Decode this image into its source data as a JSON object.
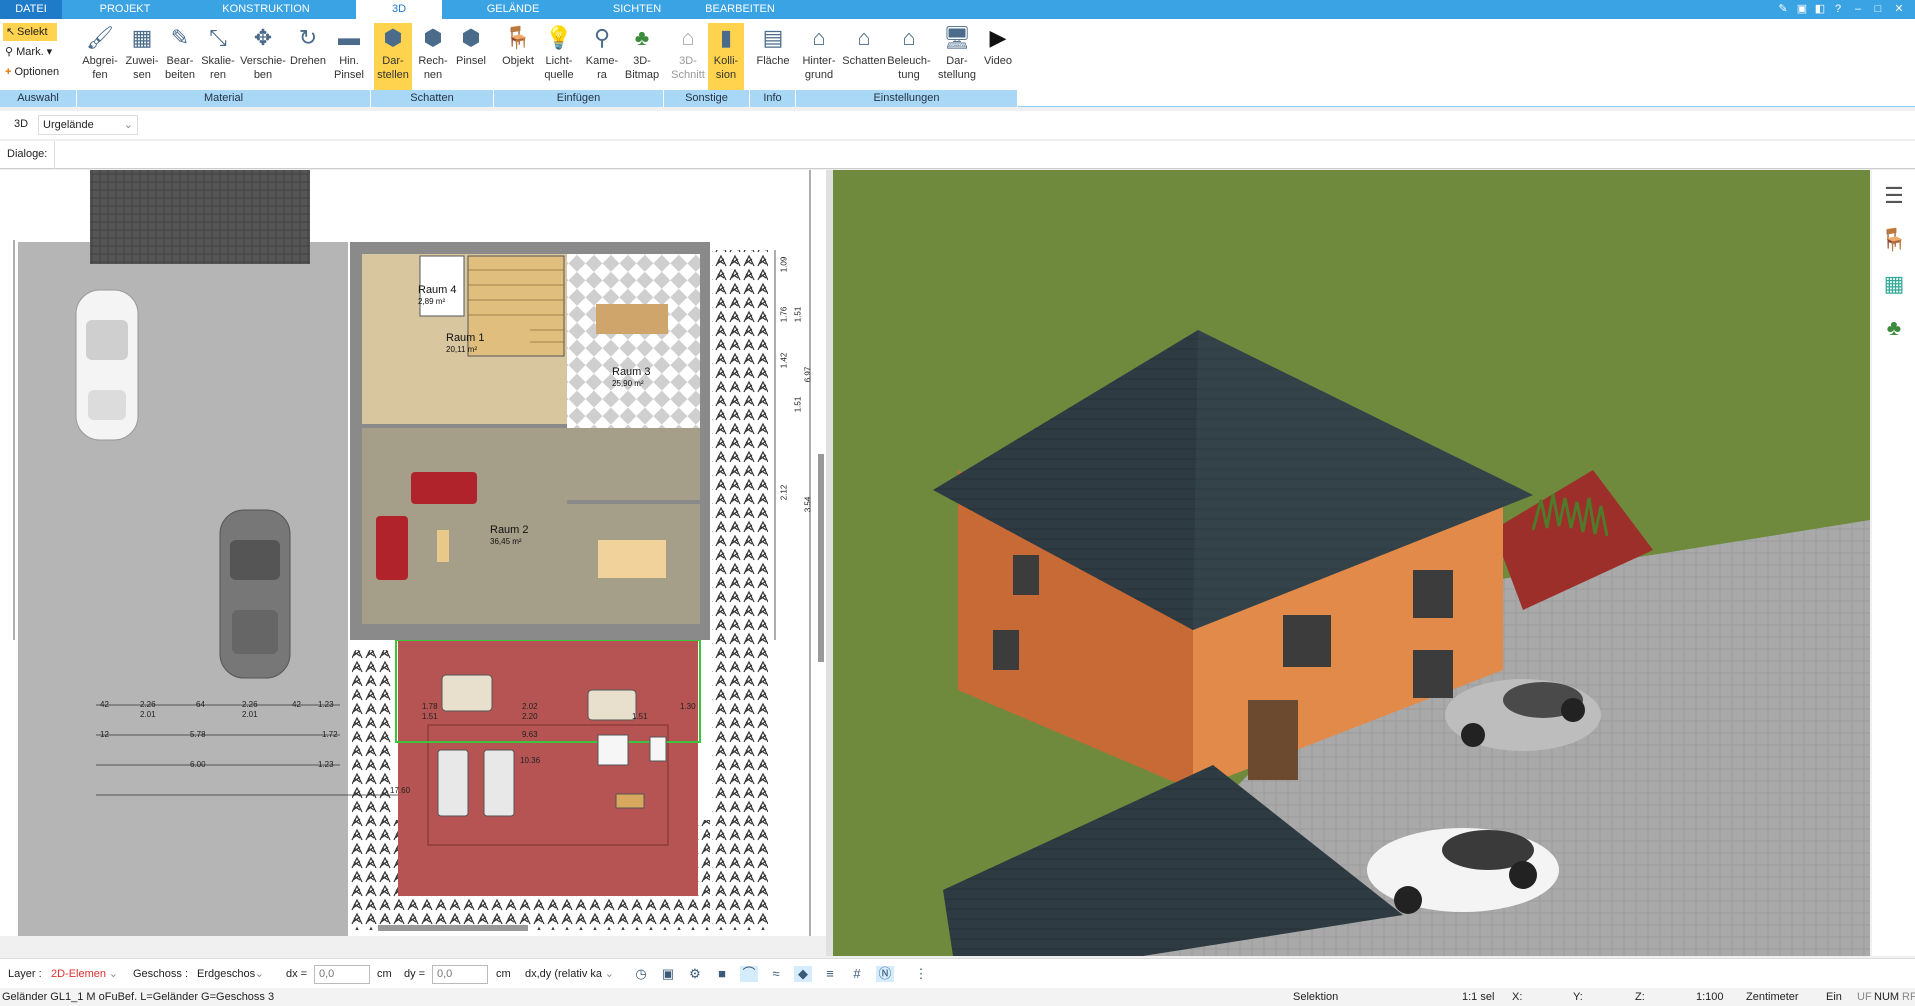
{
  "tabs": [
    "DATEI",
    "PROJEKT",
    "KONSTRUKTION",
    "3D",
    "GELÄNDE",
    "SICHTEN",
    "BEARBEITEN"
  ],
  "selection": {
    "select": "Selekt",
    "mark": "Mark.",
    "options": "Optionen"
  },
  "ribbon_buttons": [
    {
      "label": "Abgrei-\nfen",
      "icon": "eyedropper-icon"
    },
    {
      "label": "Zuwei-\nsen",
      "icon": "assign-icon"
    },
    {
      "label": "Bear-\nbeiten",
      "icon": "edit-icon"
    },
    {
      "label": "Skalie-\nren",
      "icon": "scale-icon"
    },
    {
      "label": "Verschie-\nben",
      "icon": "move-icon"
    },
    {
      "label": "Drehen",
      "icon": "rotate-icon"
    },
    {
      "label": "Hin.\nPinsel",
      "icon": "brush-icon"
    },
    {
      "label": "Dar-\nstellen",
      "icon": "display-icon",
      "active": true
    },
    {
      "label": "Rech-\nnen",
      "icon": "calculate-icon"
    },
    {
      "label": "Pinsel",
      "icon": "paint-icon"
    },
    {
      "label": "Objekt",
      "icon": "chair-icon"
    },
    {
      "label": "Licht-\nquelle",
      "icon": "lightbulb-icon"
    },
    {
      "label": "Kame-\nra",
      "icon": "camera-icon"
    },
    {
      "label": "3D-\nBitmap",
      "icon": "tree-icon"
    },
    {
      "label": "3D-\nSchnitt",
      "icon": "section-icon"
    },
    {
      "label": "Kolli-\nsion",
      "icon": "collision-icon",
      "active": true
    },
    {
      "label": "Fläche",
      "icon": "area-icon"
    },
    {
      "label": "Hinter-\ngrund",
      "icon": "background-icon"
    },
    {
      "label": "Schatten",
      "icon": "shadow-icon"
    },
    {
      "label": "Beleuch-\ntung",
      "icon": "lighting-icon"
    },
    {
      "label": "Dar-\nstellung",
      "icon": "monitor-icon"
    },
    {
      "label": "Video",
      "icon": "play-icon"
    }
  ],
  "groups": [
    "Auswahl",
    "Material",
    "Schatten",
    "Einfügen",
    "Sonstige",
    "Info",
    "Einstellungen"
  ],
  "viewbar": {
    "mode": "3D",
    "terrain": "Urgelände"
  },
  "dialogs_label": "Dialoge:",
  "rooms": [
    {
      "name": "Raum 4",
      "area": "2,89 m²"
    },
    {
      "name": "Raum 1",
      "area": "20,11 m²"
    },
    {
      "name": "Raum 3",
      "area": "25,90 m²"
    },
    {
      "name": "Raum 2",
      "area": "36,45 m²"
    }
  ],
  "dimensions": [
    "2.26",
    "2.01",
    "2.26",
    "2.01",
    "1.23",
    "1.78",
    "1.51",
    "2.02",
    "2.20",
    "1.51",
    "1.30",
    "5.78",
    "1.72",
    "6.00",
    "1.23",
    "9.63",
    "10.36",
    "17.60",
    "1.76",
    "1.51",
    "2.12",
    "3.54",
    "6.97",
    "1.09",
    "1.51",
    "1.42",
    "42",
    "64",
    "42",
    "12"
  ],
  "bottombar": {
    "layer_label": "Layer :",
    "layer_value": "2D-Elemen",
    "floor_label": "Geschoss :",
    "floor_value": "Erdgeschos",
    "dx_label": "dx =",
    "dx_value": "0,0",
    "dy_label": "dy =",
    "dy_value": "0,0",
    "unit": "cm",
    "mode_value": "dx,dy (relativ ka"
  },
  "status": {
    "left": "Geländer GL1_1 M oFuBef. L=Geländer G=Geschoss 3",
    "selection": "Selektion",
    "count": "1:1 sel",
    "x": "X:",
    "y": "Y:",
    "z": "Z:",
    "scale": "1:100",
    "unit": "Zentimeter",
    "ein": "Ein",
    "uf": "UF",
    "num": "NUM",
    "rf": "RF"
  },
  "colors": {
    "accent": "#3aa3e3",
    "ribbon_group": "#a9d8f6",
    "active": "#ffd34d",
    "roof": "#2f3b42",
    "wall": "#e0874a",
    "grass": "#6f8a3c",
    "pavement": "#a9a9a9"
  }
}
